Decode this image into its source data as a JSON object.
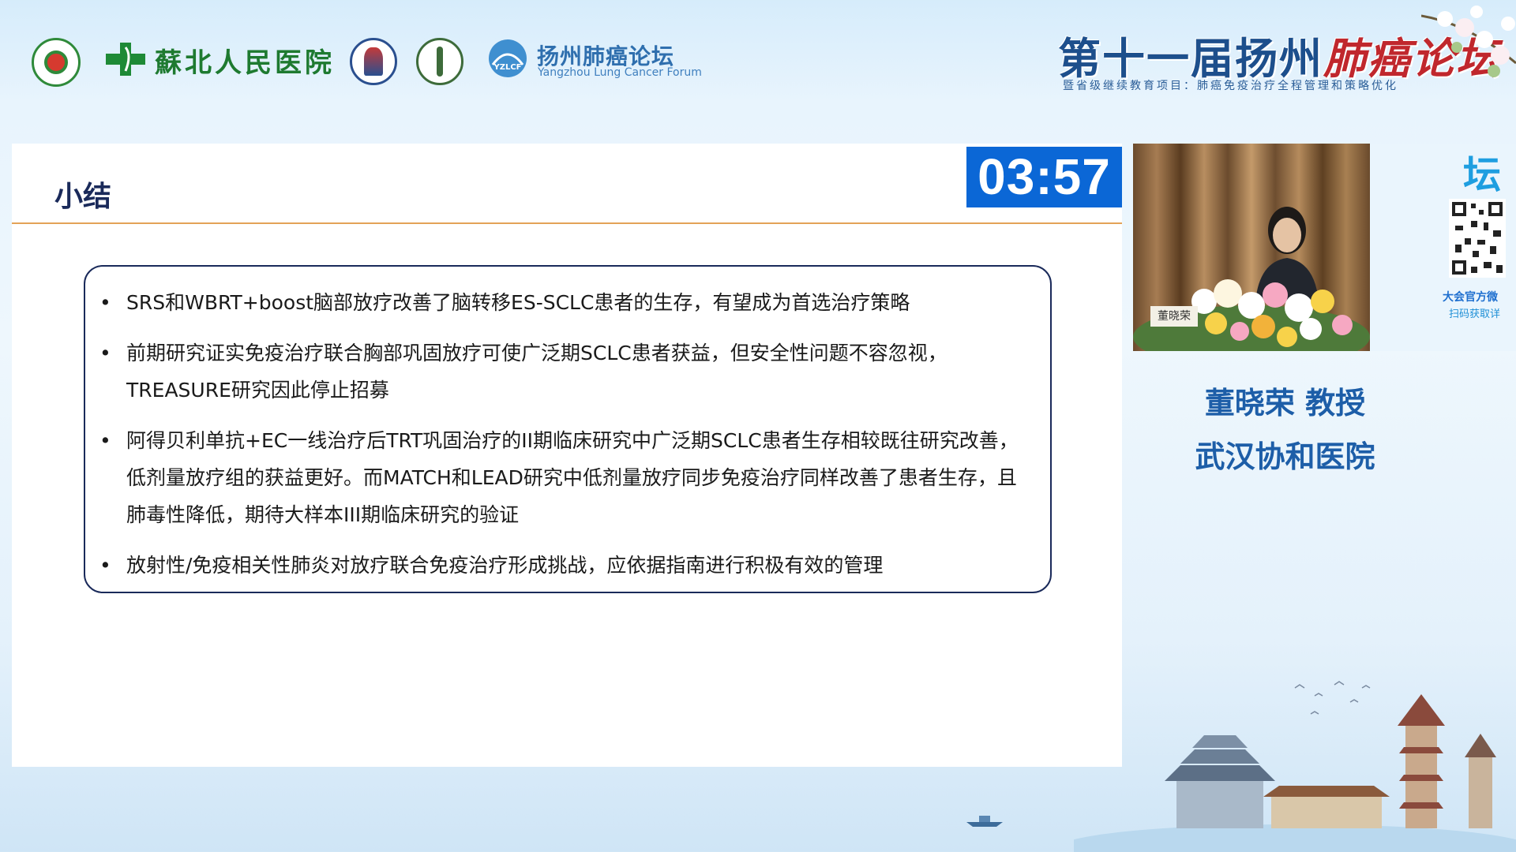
{
  "header": {
    "hospital_name": "蘇北人民医院",
    "forum_name": "扬州肺癌论坛",
    "forum_abbr": "YZLCF",
    "forum_name_en": "Yangzhou Lung Cancer Forum",
    "event_title_prefix": "第十一届扬州",
    "event_title_accent": "肺癌论坛",
    "event_subtitle": "暨省级继续教育项目：肺癌免疫治疗全程管理和策略优化"
  },
  "slide": {
    "title": "小结",
    "timer": "03:57",
    "bullets": [
      "SRS和WBRT+boost脑部放疗改善了脑转移ES-SCLC患者的生存，有望成为首选治疗策略",
      "前期研究证实免疫治疗联合胸部巩固放疗可使广泛期SCLC患者获益，但安全性问题不容忽视，TREASURE研究因此停止招募",
      "阿得贝利单抗+EC一线治疗后TRT巩固治疗的II期临床研究中广泛期SCLC患者生存相较既往研究改善，低剂量放疗组的获益更好。而MATCH和LEAD研究中低剂量放疗同步免疫治疗同样改善了患者生存，且肺毒性降低，期待大样本III期临床研究的验证",
      "放射性/免疫相关性肺炎对放疗联合免疫治疗形成挑战，应依据指南进行积极有效的管理"
    ]
  },
  "speaker": {
    "nameplate": "董晓荣",
    "name": "董晓荣 教授",
    "affiliation": "武汉协和医院"
  },
  "side_panel": {
    "char": "坛",
    "caption_1": "大会官方微",
    "caption_2": "扫码获取详"
  },
  "colors": {
    "title_navy": "#1a2a5a",
    "rule_orange": "#e3a257",
    "timer_blue": "#0b67d6",
    "speaker_blue": "#1d5ea8",
    "event_red": "#c0272d"
  }
}
